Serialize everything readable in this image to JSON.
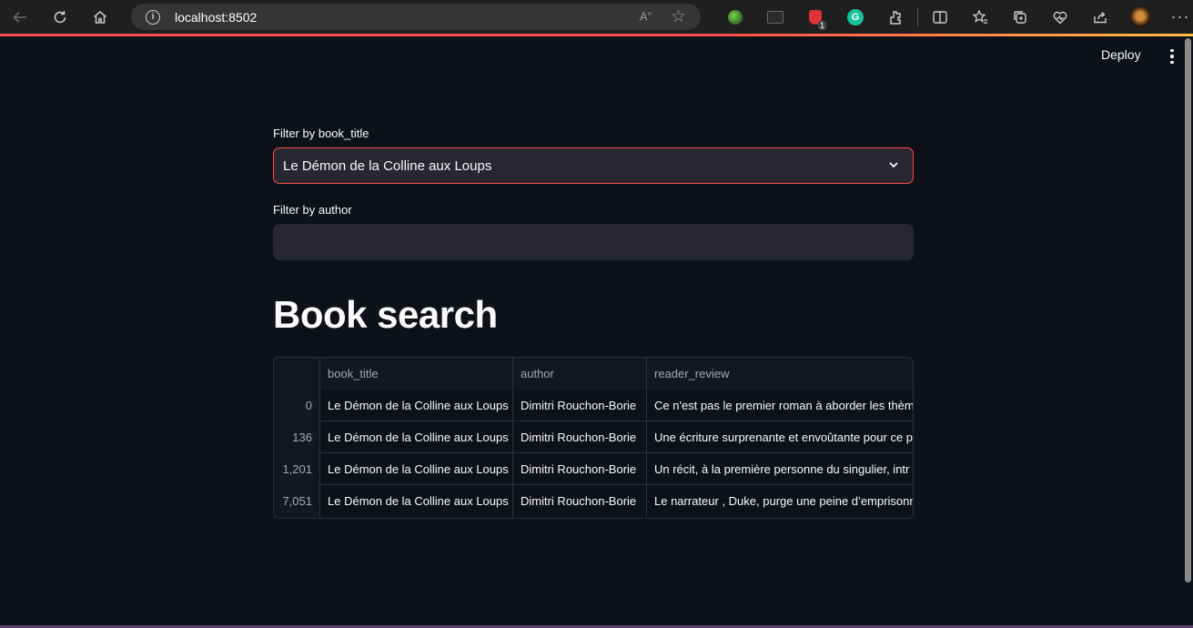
{
  "browser": {
    "url": "localhost:8502",
    "extension_badge": "1"
  },
  "header": {
    "deploy_label": "Deploy"
  },
  "filters": {
    "title_label": "Filter by book_title",
    "title_value": "Le Démon de la Colline aux Loups",
    "author_label": "Filter by author",
    "author_value": ""
  },
  "page_title": "Book search",
  "table": {
    "columns": [
      "",
      "book_title",
      "author",
      "reader_review"
    ],
    "rows": [
      {
        "index": "0",
        "book_title": "Le Démon de la Colline aux Loups",
        "author": "Dimitri Rouchon-Borie",
        "reader_review": "Ce n'est pas le premier roman à aborder les thèm"
      },
      {
        "index": "136",
        "book_title": "Le Démon de la Colline aux Loups",
        "author": "Dimitri Rouchon-Borie",
        "reader_review": "Une écriture surprenante et envoûtante pour ce p"
      },
      {
        "index": "1,201",
        "book_title": "Le Démon de la Colline aux Loups",
        "author": "Dimitri Rouchon-Borie",
        "reader_review": "Un récit, à la première personne du singulier, intr"
      },
      {
        "index": "7,051",
        "book_title": "Le Démon de la Colline aux Loups",
        "author": "Dimitri Rouchon-Borie",
        "reader_review": "Le narrateur , Duke, purge une peine d’emprisonn"
      }
    ]
  },
  "colors": {
    "background": "#0e1117",
    "accent": "#ff4b4b",
    "input_bg": "#262730"
  }
}
